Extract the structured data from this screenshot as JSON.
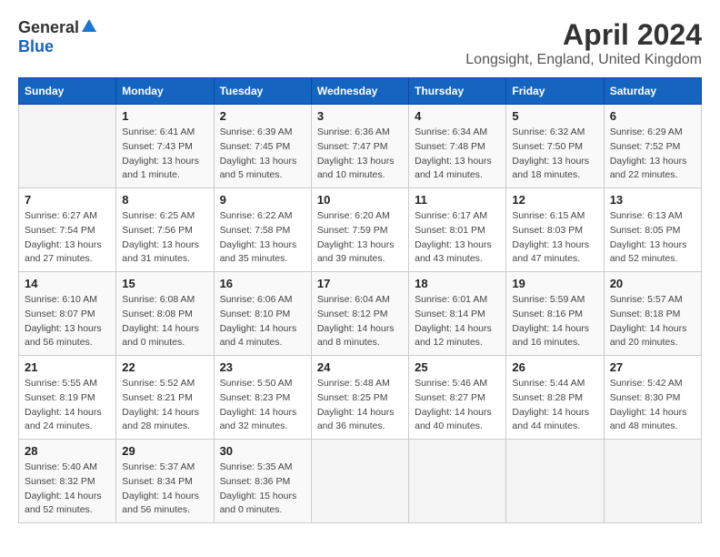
{
  "header": {
    "logo_general": "General",
    "logo_blue": "Blue",
    "month": "April 2024",
    "location": "Longsight, England, United Kingdom"
  },
  "days_of_week": [
    "Sunday",
    "Monday",
    "Tuesday",
    "Wednesday",
    "Thursday",
    "Friday",
    "Saturday"
  ],
  "weeks": [
    [
      {
        "day": "",
        "info": ""
      },
      {
        "day": "1",
        "info": "Sunrise: 6:41 AM\nSunset: 7:43 PM\nDaylight: 13 hours\nand 1 minute."
      },
      {
        "day": "2",
        "info": "Sunrise: 6:39 AM\nSunset: 7:45 PM\nDaylight: 13 hours\nand 5 minutes."
      },
      {
        "day": "3",
        "info": "Sunrise: 6:36 AM\nSunset: 7:47 PM\nDaylight: 13 hours\nand 10 minutes."
      },
      {
        "day": "4",
        "info": "Sunrise: 6:34 AM\nSunset: 7:48 PM\nDaylight: 13 hours\nand 14 minutes."
      },
      {
        "day": "5",
        "info": "Sunrise: 6:32 AM\nSunset: 7:50 PM\nDaylight: 13 hours\nand 18 minutes."
      },
      {
        "day": "6",
        "info": "Sunrise: 6:29 AM\nSunset: 7:52 PM\nDaylight: 13 hours\nand 22 minutes."
      }
    ],
    [
      {
        "day": "7",
        "info": "Sunrise: 6:27 AM\nSunset: 7:54 PM\nDaylight: 13 hours\nand 27 minutes."
      },
      {
        "day": "8",
        "info": "Sunrise: 6:25 AM\nSunset: 7:56 PM\nDaylight: 13 hours\nand 31 minutes."
      },
      {
        "day": "9",
        "info": "Sunrise: 6:22 AM\nSunset: 7:58 PM\nDaylight: 13 hours\nand 35 minutes."
      },
      {
        "day": "10",
        "info": "Sunrise: 6:20 AM\nSunset: 7:59 PM\nDaylight: 13 hours\nand 39 minutes."
      },
      {
        "day": "11",
        "info": "Sunrise: 6:17 AM\nSunset: 8:01 PM\nDaylight: 13 hours\nand 43 minutes."
      },
      {
        "day": "12",
        "info": "Sunrise: 6:15 AM\nSunset: 8:03 PM\nDaylight: 13 hours\nand 47 minutes."
      },
      {
        "day": "13",
        "info": "Sunrise: 6:13 AM\nSunset: 8:05 PM\nDaylight: 13 hours\nand 52 minutes."
      }
    ],
    [
      {
        "day": "14",
        "info": "Sunrise: 6:10 AM\nSunset: 8:07 PM\nDaylight: 13 hours\nand 56 minutes."
      },
      {
        "day": "15",
        "info": "Sunrise: 6:08 AM\nSunset: 8:08 PM\nDaylight: 14 hours\nand 0 minutes."
      },
      {
        "day": "16",
        "info": "Sunrise: 6:06 AM\nSunset: 8:10 PM\nDaylight: 14 hours\nand 4 minutes."
      },
      {
        "day": "17",
        "info": "Sunrise: 6:04 AM\nSunset: 8:12 PM\nDaylight: 14 hours\nand 8 minutes."
      },
      {
        "day": "18",
        "info": "Sunrise: 6:01 AM\nSunset: 8:14 PM\nDaylight: 14 hours\nand 12 minutes."
      },
      {
        "day": "19",
        "info": "Sunrise: 5:59 AM\nSunset: 8:16 PM\nDaylight: 14 hours\nand 16 minutes."
      },
      {
        "day": "20",
        "info": "Sunrise: 5:57 AM\nSunset: 8:18 PM\nDaylight: 14 hours\nand 20 minutes."
      }
    ],
    [
      {
        "day": "21",
        "info": "Sunrise: 5:55 AM\nSunset: 8:19 PM\nDaylight: 14 hours\nand 24 minutes."
      },
      {
        "day": "22",
        "info": "Sunrise: 5:52 AM\nSunset: 8:21 PM\nDaylight: 14 hours\nand 28 minutes."
      },
      {
        "day": "23",
        "info": "Sunrise: 5:50 AM\nSunset: 8:23 PM\nDaylight: 14 hours\nand 32 minutes."
      },
      {
        "day": "24",
        "info": "Sunrise: 5:48 AM\nSunset: 8:25 PM\nDaylight: 14 hours\nand 36 minutes."
      },
      {
        "day": "25",
        "info": "Sunrise: 5:46 AM\nSunset: 8:27 PM\nDaylight: 14 hours\nand 40 minutes."
      },
      {
        "day": "26",
        "info": "Sunrise: 5:44 AM\nSunset: 8:28 PM\nDaylight: 14 hours\nand 44 minutes."
      },
      {
        "day": "27",
        "info": "Sunrise: 5:42 AM\nSunset: 8:30 PM\nDaylight: 14 hours\nand 48 minutes."
      }
    ],
    [
      {
        "day": "28",
        "info": "Sunrise: 5:40 AM\nSunset: 8:32 PM\nDaylight: 14 hours\nand 52 minutes."
      },
      {
        "day": "29",
        "info": "Sunrise: 5:37 AM\nSunset: 8:34 PM\nDaylight: 14 hours\nand 56 minutes."
      },
      {
        "day": "30",
        "info": "Sunrise: 5:35 AM\nSunset: 8:36 PM\nDaylight: 15 hours\nand 0 minutes."
      },
      {
        "day": "",
        "info": ""
      },
      {
        "day": "",
        "info": ""
      },
      {
        "day": "",
        "info": ""
      },
      {
        "day": "",
        "info": ""
      }
    ]
  ]
}
